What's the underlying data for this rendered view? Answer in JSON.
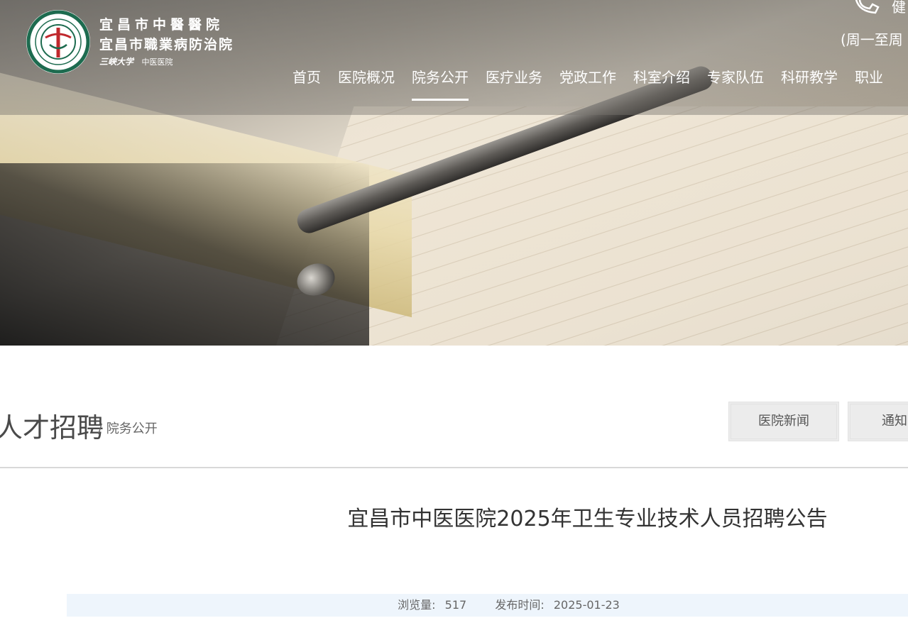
{
  "header": {
    "brand_name_1": "宜昌市中醫醫院",
    "brand_name_2": "宜昌市職業病防治院",
    "brand_university": "三峡大学",
    "brand_sub": "中医医院",
    "phone_fragment": "健",
    "hours_fragment": "(周一至周",
    "nav": [
      {
        "label": "首页"
      },
      {
        "label": "医院概况"
      },
      {
        "label": "院务公开"
      },
      {
        "label": "医疗业务"
      },
      {
        "label": "党政工作"
      },
      {
        "label": "科室介绍"
      },
      {
        "label": "专家队伍"
      },
      {
        "label": "科研教学"
      },
      {
        "label": "职业"
      }
    ],
    "active_nav_index": 2
  },
  "section": {
    "title": "人才招聘",
    "crumb": "/ 院务公开",
    "tabs": [
      {
        "label": "医院新闻"
      },
      {
        "label": "通知"
      }
    ]
  },
  "article": {
    "title": "宜昌市中医医院2025年卫生专业技术人员招聘公告",
    "views_label": "浏览量:",
    "views_value": "517",
    "date_label": "发布时间:",
    "date_value": "2025-01-23"
  },
  "colors": {
    "nav_text": "#ffffff",
    "logo_green": "#1d6b4f",
    "logo_red": "#c0282d",
    "meta_bg": "#eef5fc"
  }
}
